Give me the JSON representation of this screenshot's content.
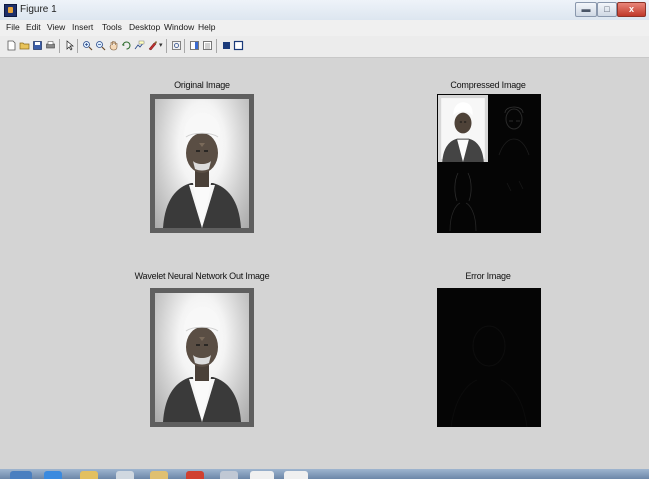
{
  "window": {
    "title": "Figure 1",
    "controls": [
      "minimize",
      "maximize",
      "close"
    ],
    "close_glyph": "x"
  },
  "menu": {
    "items": [
      "File",
      "Edit",
      "View",
      "Insert",
      "Tools",
      "Desktop",
      "Window",
      "Help"
    ]
  },
  "toolbar": {
    "icons": [
      "new-figure-icon",
      "open-file-icon",
      "save-icon",
      "print-icon",
      "edit-plot-arrow-icon",
      "zoom-in-icon",
      "zoom-out-icon",
      "pan-icon",
      "rotate-3d-icon",
      "data-cursor-icon",
      "brush-icon",
      "link-plot-icon",
      "insert-colorbar-icon",
      "insert-legend-icon",
      "hide-plot-tools-icon",
      "show-plot-tools-icon"
    ]
  },
  "figure": {
    "panels": [
      {
        "id": "original",
        "title": "Original Image",
        "kind": "photo"
      },
      {
        "id": "compressed",
        "title": "Compressed Image",
        "kind": "wavelet"
      },
      {
        "id": "wnn-out",
        "title": "Wavelet Neural Network Out Image",
        "kind": "photo"
      },
      {
        "id": "error",
        "title": "Error Image",
        "kind": "dark"
      }
    ]
  },
  "colors": {
    "figure_bg": "#d4d4d4",
    "menubar_bg": "#f0f0f0",
    "close_button": "#c0392b",
    "image_frame": "#5f5f5f",
    "dark_axes": "#050505"
  }
}
